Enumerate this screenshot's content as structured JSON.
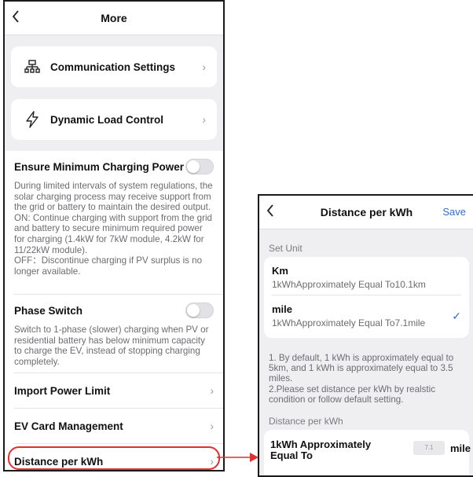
{
  "screen1": {
    "title": "More",
    "cards": [
      {
        "label": "Communication Settings",
        "icon": "network-icon"
      },
      {
        "label": "Dynamic Load Control",
        "icon": "lightning-icon"
      }
    ],
    "min_power": {
      "title": "Ensure Minimum Charging Power",
      "desc": "During limited intervals of system regulations, the solar charging process may receive support from the grid or battery to maintain the desired output.\nON: Continue charging with support from the grid and battery to secure minimum required power for charging (1.4kW for 7kW module, 4.2kW for 11/22kW module).\nOFF：Discontinue charging if PV surplus is no longer available.",
      "enabled": false
    },
    "phase_switch": {
      "title": "Phase Switch",
      "desc": "Switch to 1-phase (slower) charging when PV or residential battery has below minimum capacity to charge the EV, instead of stopping charging completely.",
      "enabled": false
    },
    "rows": [
      "Import Power Limit",
      "EV Card Management",
      "Distance per kWh"
    ]
  },
  "screen2": {
    "title": "Distance per kWh",
    "save": "Save",
    "set_unit_label": "Set Unit",
    "units": [
      {
        "name": "Km",
        "desc": "1kWhApproximately Equal To10.1km",
        "selected": false
      },
      {
        "name": "mile",
        "desc": "1kWhApproximately Equal To7.1mile",
        "selected": true
      }
    ],
    "note": "1. By default, 1 kWh is approximately equal to 5km, and 1 kWh is approximately equal to 3.5 miles.\n2.Please set distance per kWh by realstic condition or follow default setting.",
    "distance_label": "Distance per kWh",
    "distance_field_label": "1kWh Approximately Equal To",
    "distance_value": "7.1",
    "distance_unit": "mile"
  },
  "colors": {
    "accent": "#2c6fd6",
    "highlight": "#e03030",
    "background": "#efeff1"
  }
}
